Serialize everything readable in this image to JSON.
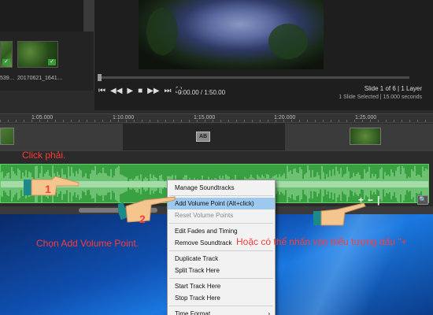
{
  "media": {
    "thumbs": [
      {
        "caption": "539…",
        "checked": true
      },
      {
        "caption": "20170621_1641…",
        "checked": true
      }
    ],
    "check_glyph": "✓"
  },
  "preview": {
    "controls": {
      "skip_start": "⏮",
      "rewind": "◀◀",
      "play": "▶",
      "stop": "■",
      "forward": "▶▶",
      "skip_end": "⏭",
      "fullscreen": "⛶"
    },
    "time": "0:00.00 / 1:50.00",
    "slide_info": "Slide 1 of 6  |  1 Layer",
    "slide_sub": "1 Slide Selected  |  15.000 seconds",
    "scrub_progress": 0.0
  },
  "ruler": {
    "labels": [
      "1:05.000",
      "1:10.000",
      "1:15.000",
      "1:20.000",
      "1:25.000"
    ]
  },
  "slide_track": {
    "transition_label": "AB"
  },
  "sound_track": {
    "tools": {
      "add": "+",
      "remove": "−",
      "marker": "|",
      "zoom": "🔍"
    }
  },
  "context_menu": {
    "items": [
      {
        "label": "Manage Soundtracks",
        "state": "normal"
      },
      {
        "separator": true
      },
      {
        "label": "Add Volume Point (Alt+click)",
        "state": "highlight"
      },
      {
        "label": "Reset Volume Points",
        "state": "disabled"
      },
      {
        "separator": true
      },
      {
        "label": "Edit Fades and Timing",
        "state": "normal"
      },
      {
        "label": "Remove Soundtrack",
        "state": "normal"
      },
      {
        "separator": true
      },
      {
        "label": "Duplicate Track",
        "state": "normal"
      },
      {
        "label": "Split Track Here",
        "state": "normal"
      },
      {
        "separator": true
      },
      {
        "label": "Start Track Here",
        "state": "normal"
      },
      {
        "label": "Stop Track Here",
        "state": "normal"
      },
      {
        "separator": true
      },
      {
        "label": "Time Format",
        "state": "normal",
        "submenu": "›"
      }
    ]
  },
  "annotations": {
    "click": "Click phải.",
    "step1": "1",
    "step2": "2",
    "add": "Chọn Add Volume Point.",
    "or": "Hoặc có thể nhấn vào biểu tượng dấu \"+"
  },
  "colors": {
    "track_green": "#3aa143",
    "annotation_red": "#ff3b3b",
    "menu_highlight": "#9ec9ee"
  }
}
